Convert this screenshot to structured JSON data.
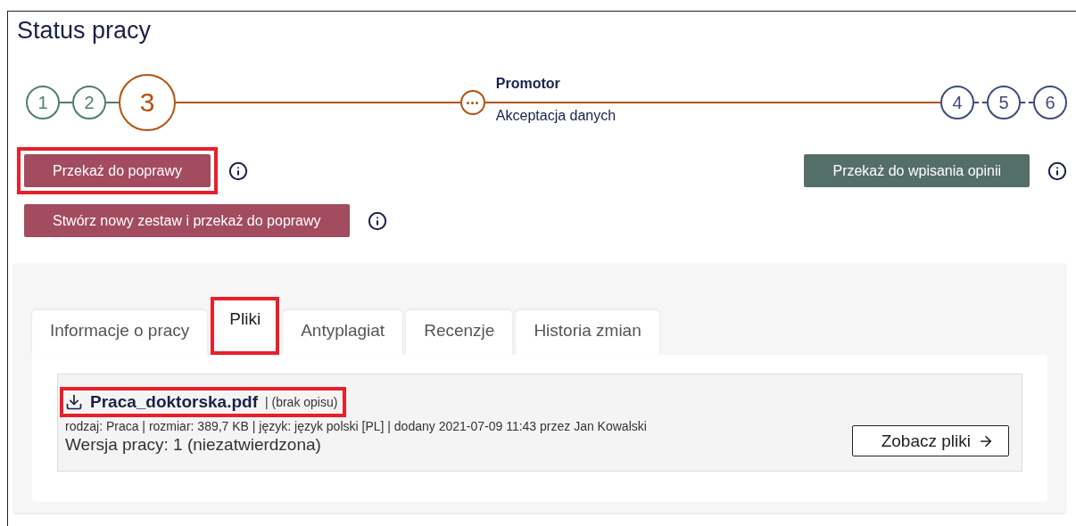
{
  "title": "Status pracy",
  "steps": [
    {
      "kind": "step",
      "label": "1",
      "done": true,
      "current": false
    },
    {
      "kind": "step",
      "label": "2",
      "done": true,
      "current": false
    },
    {
      "kind": "step",
      "label": "3",
      "done": false,
      "current": true
    },
    {
      "kind": "more",
      "title": "Promotor",
      "subtitle": "Akceptacja danych",
      "done": false,
      "current": true
    },
    {
      "kind": "step",
      "label": "4",
      "done": false,
      "current": false
    },
    {
      "kind": "step",
      "label": "5",
      "done": false,
      "current": false
    },
    {
      "kind": "step",
      "label": "6",
      "done": false,
      "current": false
    }
  ],
  "actions_left": [
    {
      "label": "Przekaż do poprawy",
      "color": "#a34b5f",
      "highlighted": true
    },
    {
      "label": "Stwórz nowy zestaw i przekaż do poprawy",
      "color": "#a34b5f",
      "highlighted": false
    }
  ],
  "actions_right": [
    {
      "label": "Przekaż do wpisania opinii",
      "color": "#546e69",
      "highlighted": false
    }
  ],
  "tabs": [
    {
      "label": "Informacje o pracy",
      "selected": false,
      "highlighted": false
    },
    {
      "label": "Pliki",
      "selected": true,
      "highlighted": true
    },
    {
      "label": "Antyplagiat",
      "selected": false,
      "highlighted": false
    },
    {
      "label": "Recenzje",
      "selected": false,
      "highlighted": false
    },
    {
      "label": "Historia zmian",
      "selected": false,
      "highlighted": false
    }
  ],
  "file": {
    "name": "Praca_doktorska.pdf",
    "note": "| (brak opisu)",
    "highlighted": true,
    "meta": "rodzaj: Praca | rozmiar: 389,7 KB | język: język polski [PL] | dodany 2021-07-09 11:43 przez Jan Kowalski",
    "version": "Wersja pracy: 1 (niezatwierdzona)",
    "button": "Zobacz pliki"
  }
}
